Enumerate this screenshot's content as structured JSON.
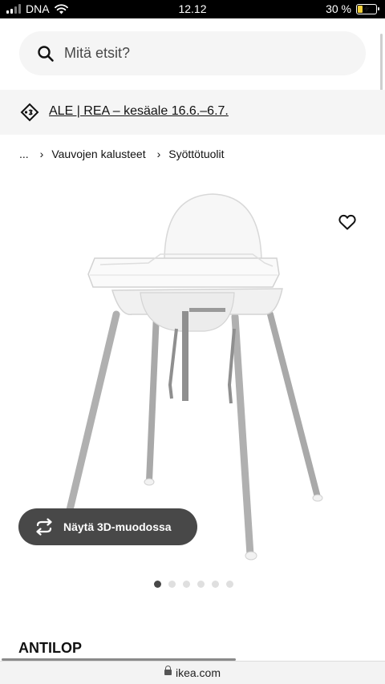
{
  "status_bar": {
    "carrier": "DNA",
    "time": "12.12",
    "battery_text": "30 %",
    "battery_level": 0.3,
    "icons": [
      "cellular-signal-icon",
      "wifi-icon",
      "battery-charging-icon"
    ]
  },
  "search": {
    "placeholder": "Mitä etsit?",
    "icon": "search-icon"
  },
  "promo": {
    "icon": "price-tag-icon",
    "text": "ALE | REA – kesäale 16.6.–6.7."
  },
  "breadcrumb": {
    "items": [
      "...",
      "Vauvojen kalusteet",
      "Syöttötuolit"
    ],
    "separator": "›"
  },
  "gallery": {
    "favorite_icon": "heart-outline-icon",
    "view_3d_label": "Näytä 3D-muodossa",
    "view_3d_icon": "rotate-3d-icon",
    "image_count": 6,
    "active_index": 0
  },
  "product": {
    "name": "ANTILOP"
  },
  "browser": {
    "url": "ikea.com",
    "lock_icon": "lock-icon"
  },
  "colors": {
    "accent_dark": "#484848",
    "background_light": "#f5f5f5",
    "battery_fill": "#f2d03b"
  }
}
